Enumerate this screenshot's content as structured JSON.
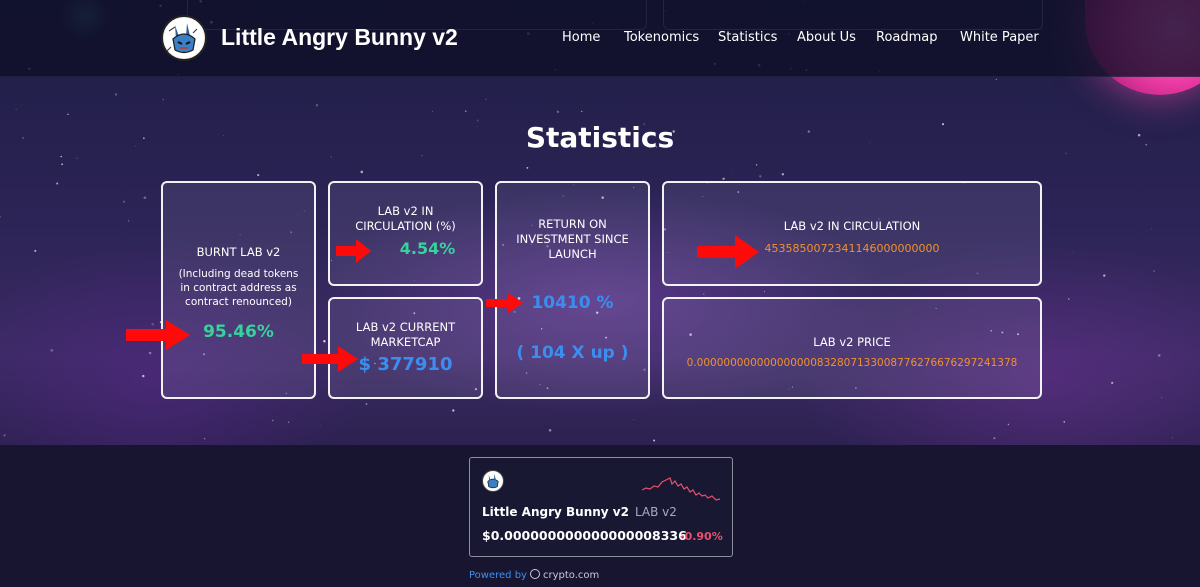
{
  "header": {
    "brand": "Little Angry Bunny v2",
    "nav": [
      {
        "label": "Home"
      },
      {
        "label": "Tokenomics"
      },
      {
        "label": "Statistics"
      },
      {
        "label": "About Us"
      },
      {
        "label": "Roadmap"
      },
      {
        "label": "White Paper"
      }
    ]
  },
  "page_title": "Statistics",
  "stats": {
    "burnt": {
      "label": "BURNT LAB v2",
      "note": "(Including dead tokens in contract address as contract renounced)",
      "value": "95.46%"
    },
    "circ_pct": {
      "label": "LAB v2 IN CIRCULATION (%)",
      "value": "4.54%"
    },
    "marketcap": {
      "label": "LAB v2 CURRENT MARKETCAP",
      "value": "$ 377910"
    },
    "roi": {
      "label": "RETURN ON INVESTMENT SINCE LAUNCH",
      "value": "10410 %",
      "multiple": "( 104 X up )"
    },
    "circulation": {
      "label": "LAB v2 IN CIRCULATION",
      "value": "4535850072341146000000000"
    },
    "price": {
      "label": "LAB v2 PRICE",
      "value": "0.000000000000000000832807133008776276676297241378"
    }
  },
  "widget": {
    "name": "Little Angry Bunny v2",
    "symbol": "LAB v2",
    "price": "$0.000000000000000008336",
    "change": "-0.90%",
    "powered_prefix": "Powered by",
    "powered_brand": "crypto.com"
  },
  "colors": {
    "green": "#37d39d",
    "blue": "#3b8ef0",
    "orange": "#f0922b",
    "arrow": "#ff0a0a",
    "negative": "#e8506b"
  }
}
